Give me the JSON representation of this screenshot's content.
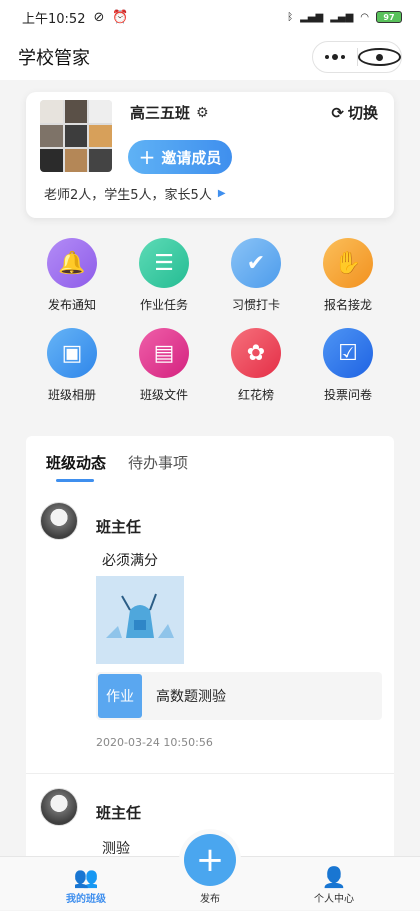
{
  "status_bar": {
    "time": "上午10:52",
    "battery": "97"
  },
  "navbar": {
    "title": "学校管家"
  },
  "class_card": {
    "name": "高三五班",
    "switch_label": "切换",
    "invite_label": "邀请成员",
    "members_summary": "老师2人，学生5人，家长5人"
  },
  "functions": [
    {
      "label": "发布通知",
      "icon": "bell-icon",
      "color": "#9b6cf0"
    },
    {
      "label": "作业任务",
      "icon": "list-icon",
      "color": "#30c7a0"
    },
    {
      "label": "习惯打卡",
      "icon": "check-icon",
      "color": "#5aa7f0"
    },
    {
      "label": "报名接龙",
      "icon": "hand-icon",
      "color": "#f5a032"
    },
    {
      "label": "班级相册",
      "icon": "album-icon",
      "color": "#3f96ee"
    },
    {
      "label": "班级文件",
      "icon": "file-icon",
      "color": "#e0368f"
    },
    {
      "label": "红花榜",
      "icon": "flower-icon",
      "color": "#ef4a5a"
    },
    {
      "label": "投票问卷",
      "icon": "vote-icon",
      "color": "#2b74ec"
    }
  ],
  "feed": {
    "tabs": [
      "班级动态",
      "待办事项"
    ],
    "posts": [
      {
        "author": "班主任",
        "content": "必须满分",
        "task_tag": "作业",
        "task_title": "高数题测验",
        "time": "2020-03-24 10:50:56"
      },
      {
        "author": "班主任",
        "content": "测验"
      }
    ]
  },
  "tabbar": {
    "items": [
      "我的班级",
      "发布",
      "个人中心"
    ],
    "active_color": "#3f8fee"
  }
}
